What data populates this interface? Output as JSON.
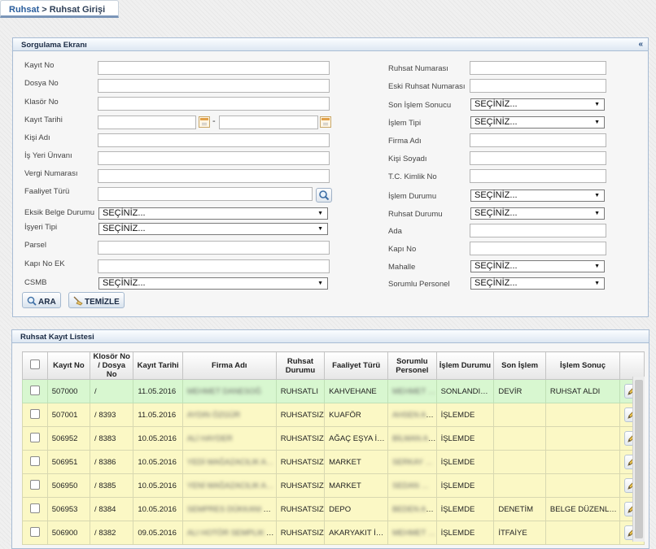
{
  "breadcrumb": {
    "root": "Ruhsat",
    "separator": ">",
    "current": "Ruhsat Girişi"
  },
  "query_panel": {
    "title": "Sorgulama Ekranı",
    "collapse_glyph": "«",
    "left_fields": [
      {
        "label": "Kayıt No",
        "type": "text"
      },
      {
        "label": "Dosya No",
        "type": "text"
      },
      {
        "label": "Klasör No",
        "type": "text"
      },
      {
        "label": "Kayıt Tarihi",
        "type": "daterange"
      },
      {
        "label": "Kişi Adı",
        "type": "text"
      },
      {
        "label": "İş Yeri Ünvanı",
        "type": "text"
      },
      {
        "label": "Vergi Numarası",
        "type": "text"
      },
      {
        "label": "Faaliyet Türü",
        "type": "lookup"
      },
      {
        "label": "Eksik Belge Durumu",
        "type": "select",
        "value": "SEÇİNİZ..."
      },
      {
        "label": "İşyeri Tipi",
        "type": "select",
        "value": "SEÇİNİZ..."
      },
      {
        "label": "Parsel",
        "type": "text"
      },
      {
        "label": "Kapı No EK",
        "type": "text"
      },
      {
        "label": "CSMB",
        "type": "select",
        "value": "SEÇİNİZ..."
      }
    ],
    "right_fields": [
      {
        "label": "Ruhsat Numarası",
        "type": "text"
      },
      {
        "label": "Eski Ruhsat Numarası",
        "type": "text"
      },
      {
        "label": "Son İşlem Sonucu",
        "type": "select",
        "value": "SEÇİNİZ..."
      },
      {
        "label": "İşlem Tipi",
        "type": "select",
        "value": "SEÇİNİZ..."
      },
      {
        "label": "Firma Adı",
        "type": "text"
      },
      {
        "label": "Kişi Soyadı",
        "type": "text"
      },
      {
        "label": "T.C. Kimlik No",
        "type": "text"
      },
      {
        "label": "İşlem Durumu",
        "type": "select",
        "value": "SEÇİNİZ..."
      },
      {
        "label": "Ruhsat Durumu",
        "type": "select",
        "value": "SEÇİNİZ..."
      },
      {
        "label": "Ada",
        "type": "text"
      },
      {
        "label": "Kapı No",
        "type": "text"
      },
      {
        "label": "Mahalle",
        "type": "select",
        "value": "SEÇİNİZ..."
      },
      {
        "label": "Sorumlu Personel",
        "type": "select",
        "value": "SEÇİNİZ..."
      }
    ],
    "date_separator": "-",
    "buttons": {
      "search": "ARA",
      "clear": "TEMİZLE"
    }
  },
  "list_panel": {
    "title": "Ruhsat Kayıt Listesi",
    "columns": [
      "",
      "Kayıt No",
      "Klosör No / Dosya No",
      "Kayıt Tarihi",
      "Firma Adı",
      "Ruhsat Durumu",
      "Faaliyet Türü",
      "Sorumlu Personel",
      "İşlem Durumu",
      "Son İşlem",
      "İşlem Sonuç",
      ""
    ],
    "rows": [
      {
        "status": "ok",
        "kayit_no": "507000",
        "klasor": "/",
        "tarih": "11.05.2016",
        "firma": "MEHMET DANESOĞ",
        "ruhsat": "RUHSATLI",
        "faaliyet": "KAHVEHANE",
        "personel": "MEHMET …",
        "islem": "SONLANDI…",
        "son": "DEVİR",
        "sonuc": "RUHSAT ALDI"
      },
      {
        "status": "wip",
        "kayit_no": "507001",
        "klasor": "/ 8393",
        "tarih": "11.05.2016",
        "firma": "AYDIN ÖZGÜR",
        "ruhsat": "RUHSATSIZ",
        "faaliyet": "KUAFÖR",
        "personel": "AHSEN ALTI",
        "islem": "İŞLEMDE",
        "son": "",
        "sonuc": ""
      },
      {
        "status": "wip",
        "kayit_no": "506952",
        "klasor": "/ 8383",
        "tarih": "10.05.2016",
        "firma": "ALİ HAYDER",
        "ruhsat": "RUHSATSIZ",
        "faaliyet": "AĞAÇ EŞYA İ…",
        "personel": "BİLMAN ALA…",
        "islem": "İŞLEMDE",
        "son": "",
        "sonuc": ""
      },
      {
        "status": "wip",
        "kayit_no": "506951",
        "klasor": "/ 8386",
        "tarih": "10.05.2016",
        "firma": "YEDİ MAĞAZACILIK A…",
        "ruhsat": "RUHSATSIZ",
        "faaliyet": "MARKET",
        "personel": "SERKAY …",
        "islem": "İŞLEMDE",
        "son": "",
        "sonuc": ""
      },
      {
        "status": "wip",
        "kayit_no": "506950",
        "klasor": "/ 8385",
        "tarih": "10.05.2016",
        "firma": "YENİ MAĞAZACILIK A…",
        "ruhsat": "RUHSATSIZ",
        "faaliyet": "MARKET",
        "personel": "SEDAN …",
        "islem": "İŞLEMDE",
        "son": "",
        "sonuc": ""
      },
      {
        "status": "wip",
        "kayit_no": "506953",
        "klasor": "/ 8384",
        "tarih": "10.05.2016",
        "firma": "SEMPRES DÜKKANI A…",
        "ruhsat": "RUHSATSIZ",
        "faaliyet": "DEPO",
        "personel": "BEDEN ALA…",
        "islem": "İŞLEMDE",
        "son": "DENETİM",
        "sonuc": "BELGE DÜZENL…"
      },
      {
        "status": "wip",
        "kayit_no": "506900",
        "klasor": "/ 8382",
        "tarih": "09.05.2016",
        "firma": "ALI HOTÖR SEMPLIK A…",
        "ruhsat": "RUHSATSIZ",
        "faaliyet": "AKARYAKIT İ…",
        "personel": "MEHMET …",
        "islem": "İŞLEMDE",
        "son": "İTFAİYE",
        "sonuc": ""
      }
    ]
  }
}
